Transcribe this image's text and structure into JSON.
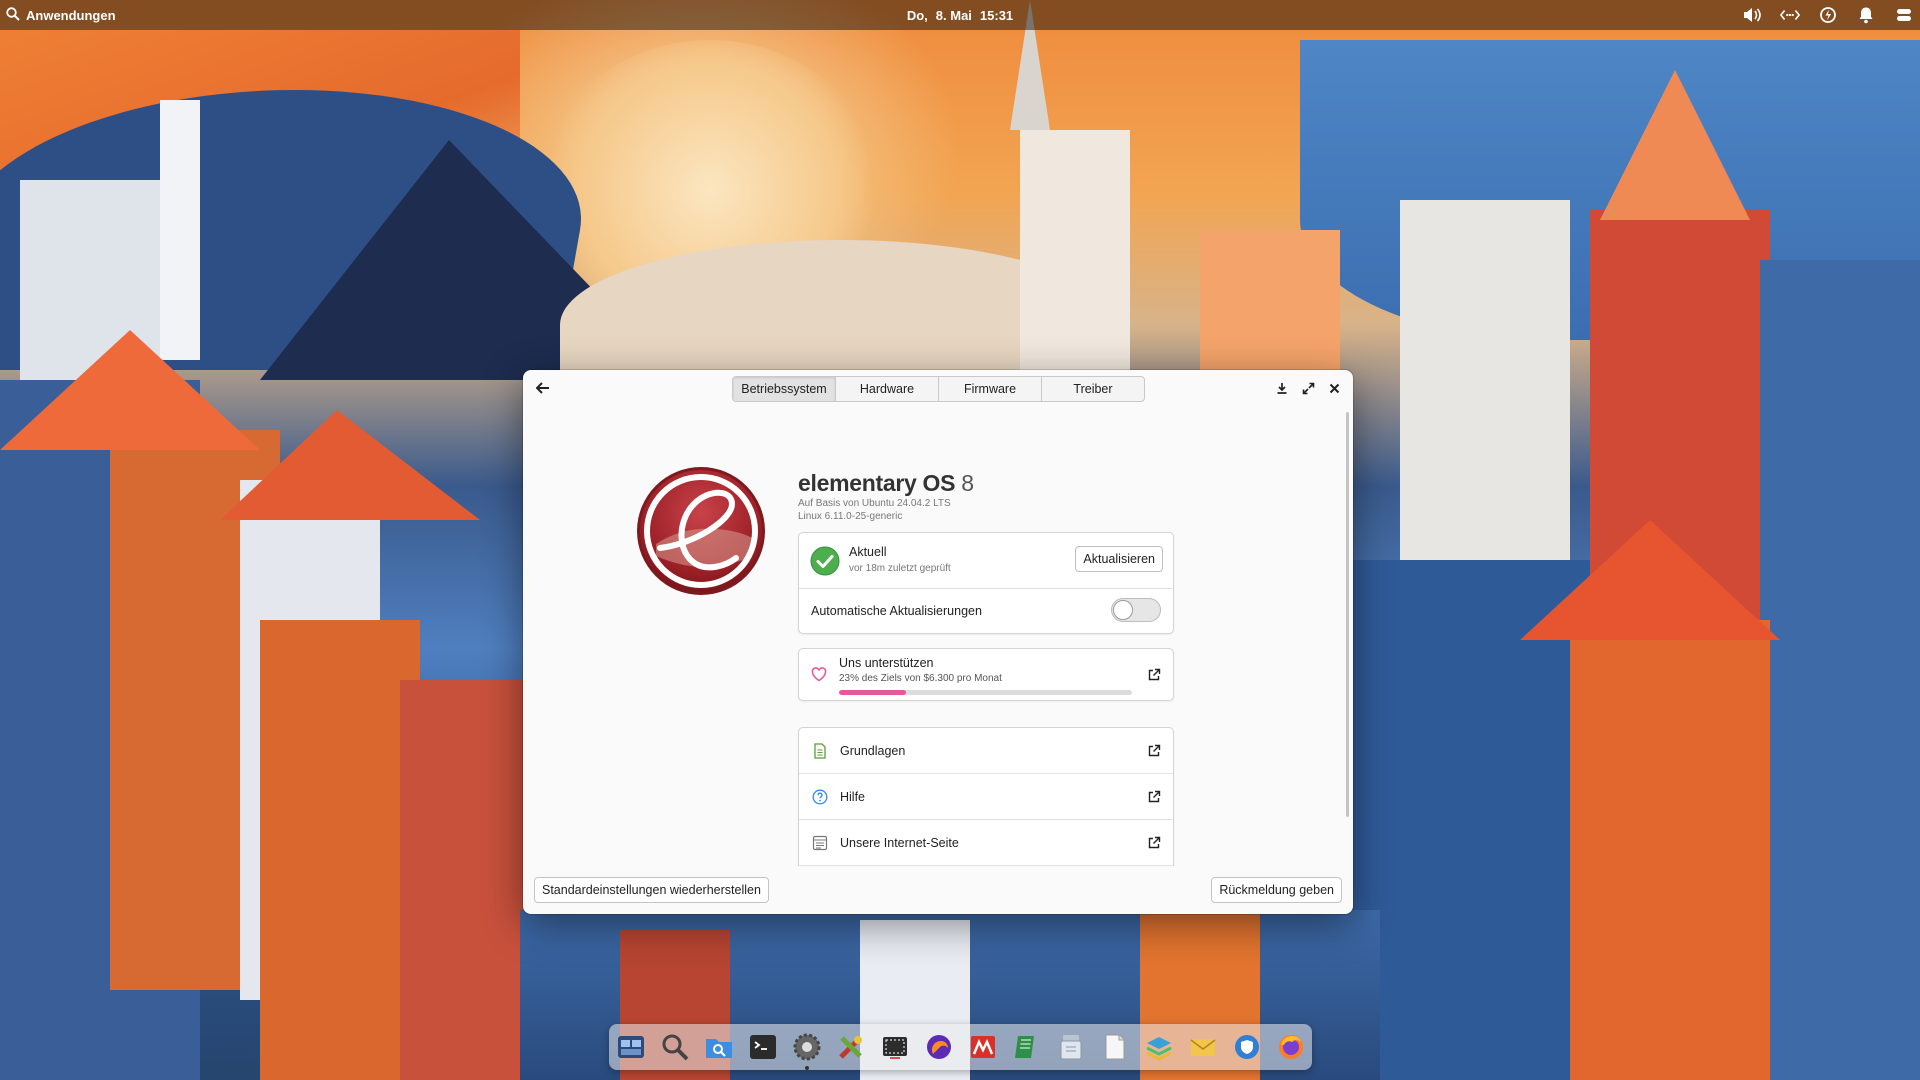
{
  "panel": {
    "apps_label": "Anwendungen",
    "date": "Do,",
    "day": "8. Mai",
    "time": "15:31",
    "indicators": [
      "volume-icon",
      "network-icon",
      "power-icon",
      "notifications-icon",
      "session-icon"
    ]
  },
  "window": {
    "tabs": [
      "Betriebssystem",
      "Hardware",
      "Firmware",
      "Treiber"
    ],
    "active_tab": "Betriebssystem",
    "os_name": "elementary OS",
    "os_version": "8",
    "base": "Auf Basis von Ubuntu 24.04.2 LTS",
    "kernel": "Linux 6.11.0-25-generic",
    "update": {
      "status": "Aktuell",
      "checked": "vor 18m zuletzt geprüft",
      "button": "Aktualisieren"
    },
    "auto_updates": {
      "label": "Automatische Aktualisierungen",
      "enabled": false
    },
    "support": {
      "title": "Uns unterstützen",
      "subtitle": "23% des Ziels von $6.300 pro Monat",
      "progress": 0.23
    },
    "links": [
      {
        "label": "Grundlagen",
        "icon": "document-icon"
      },
      {
        "label": "Hilfe",
        "icon": "help-icon"
      },
      {
        "label": "Unsere Internet-Seite",
        "icon": "website-icon"
      }
    ],
    "reset_button": "Standardeinstellungen wiederherstellen",
    "feedback_button": "Rückmeldung geben"
  },
  "dock": {
    "apps": [
      "multitasking-icon",
      "search-icon",
      "files-icon",
      "terminal-icon",
      "settings-icon",
      "tools-icon",
      "screenshot-icon",
      "firefox-dev-icon",
      "pdf-icon",
      "notes-icon",
      "package-icon",
      "text-editor-icon",
      "layers-icon",
      "mail-icon",
      "shield-icon",
      "firefox-icon"
    ],
    "running": "settings-icon"
  },
  "colors": {
    "accent_pink": "#e7579b",
    "success_green": "#4cae4c",
    "logo_red": "#a8232a"
  }
}
